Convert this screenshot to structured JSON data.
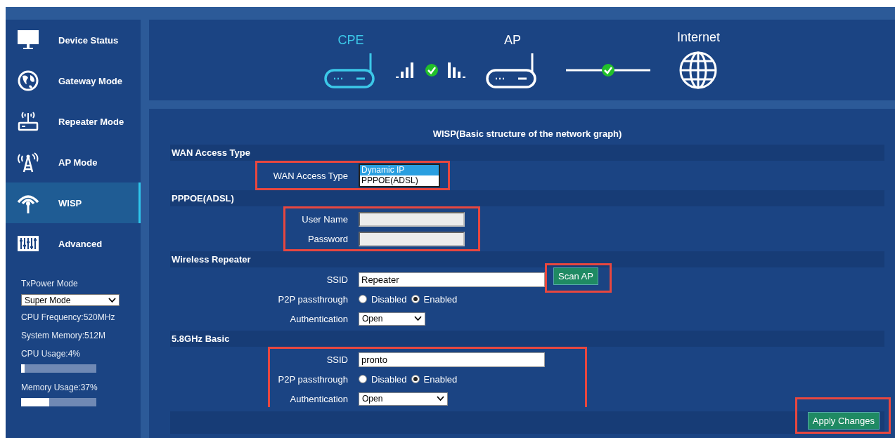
{
  "sidebar": {
    "items": [
      {
        "label": "Device Status",
        "selected": false
      },
      {
        "label": "Gateway Mode",
        "selected": false
      },
      {
        "label": "Repeater Mode",
        "selected": false
      },
      {
        "label": "AP Mode",
        "selected": false
      },
      {
        "label": "WISP",
        "selected": true
      },
      {
        "label": "Advanced",
        "selected": false
      }
    ],
    "system": {
      "txpower_label": "TxPower Mode",
      "txpower_value": "Super Mode",
      "cpu_frequency": "CPU Frequency:520MHz",
      "system_memory": "System Memory:512M",
      "cpu_usage": {
        "label": "CPU Usage:4%",
        "level": 0.05
      },
      "memory_usage": {
        "label": "Memory Usage:37%",
        "level": 0.37
      }
    }
  },
  "topology": {
    "nodes": [
      {
        "label": "CPE",
        "selected": true
      },
      {
        "label": "AP",
        "selected": false
      },
      {
        "label": "Internet",
        "selected": false
      }
    ]
  },
  "form": {
    "title": "WISP(Basic structure of the network graph)",
    "sections": [
      {
        "title": "WAN Access Type",
        "highlighted": true,
        "rows": [
          {
            "kind": "listbox",
            "label": "WAN Access Type",
            "options": [
              {
                "label": "Dynamic IP",
                "selected": true
              },
              {
                "label": "PPPOE(ADSL)",
                "selected": false
              }
            ]
          }
        ]
      },
      {
        "title": "PPPOE(ADSL)",
        "highlighted": true,
        "rows": [
          {
            "kind": "text",
            "label": "User Name",
            "disabled": true
          },
          {
            "kind": "text",
            "label": "Password",
            "disabled": true
          }
        ]
      },
      {
        "title": "Wireless Repeater",
        "highlighted": false,
        "rows": [
          {
            "kind": "text",
            "label": "SSID",
            "value": "Repeater",
            "disabled": false,
            "button": {
              "label": "Scan AP",
              "highlighted": true
            }
          },
          {
            "kind": "radio",
            "label": "P2P passthrough",
            "options": [
              {
                "label": "Disabled",
                "selected": false
              },
              {
                "label": "Enabled",
                "selected": true
              }
            ]
          },
          {
            "kind": "select",
            "label": "Authentication",
            "value": "Open"
          }
        ]
      },
      {
        "title": "5.8GHz Basic",
        "highlighted": true,
        "rows": [
          {
            "kind": "text",
            "label": "SSID",
            "value": "pronto",
            "disabled": false
          },
          {
            "kind": "radio",
            "label": "P2P passthrough",
            "options": [
              {
                "label": "Disabled",
                "selected": false
              },
              {
                "label": "Enabled",
                "selected": true
              }
            ]
          },
          {
            "kind": "select",
            "label": "Authentication",
            "value": "Open",
            "wide": true
          }
        ]
      }
    ],
    "apply_button": {
      "label": "Apply Changes",
      "highlighted": true
    }
  }
}
